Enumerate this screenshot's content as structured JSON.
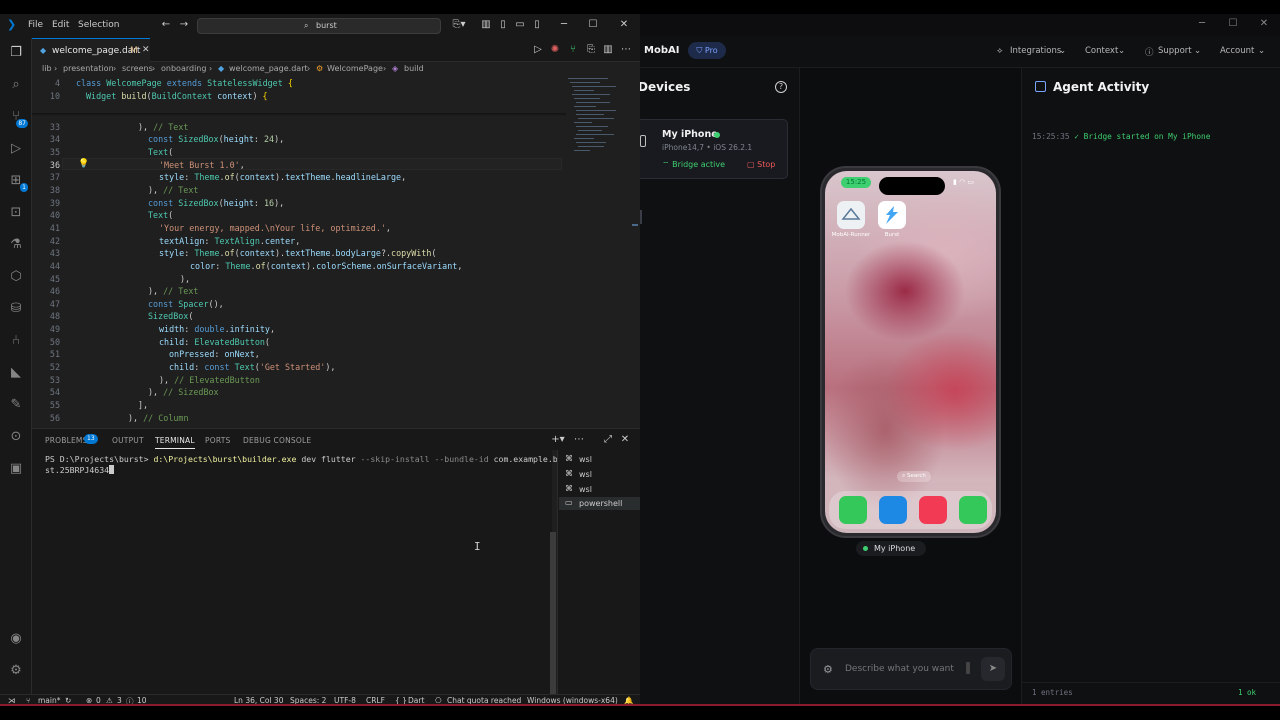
{
  "vscode": {
    "menu": [
      "File",
      "Edit",
      "Selection"
    ],
    "search": "burst",
    "tab": {
      "name": "welcome_page.dart",
      "modified": "M"
    },
    "breadcrumb": [
      "lib",
      "presentation",
      "screens",
      "onboarding",
      "welcome_page.dart",
      "WelcomePage",
      "build"
    ],
    "status": {
      "branch": "main*",
      "problems": "0",
      "warnings": "3",
      "info": "10",
      "position": "Ln 36, Col 30",
      "spaces": "Spaces: 2",
      "encoding": "UTF-8",
      "eol": "CRLF",
      "language": "Dart",
      "chat": "Chat quota reached",
      "platform": "Windows (windows-x64)"
    },
    "panel": {
      "tabs": [
        "PROBLEMS",
        "OUTPUT",
        "TERMINAL",
        "PORTS",
        "DEBUG CONSOLE"
      ],
      "problems_count": "13",
      "terminal_prompt": "PS D:\\Projects\\burst> ",
      "terminal_exe": "d:\\Projects\\burst\\builder.exe",
      "terminal_args1": " dev flutter ",
      "terminal_flags": "--skip-install --bundle-id ",
      "terminal_bundle1": "com.example.bur",
      "terminal_line2": "st.25BRPJ4634",
      "terminals": [
        "wsl",
        "wsl",
        "wsl",
        "powershell"
      ]
    },
    "activity_badges": {
      "scm": "87",
      "extensions": "1"
    }
  },
  "mobai": {
    "title": "MobAI",
    "plan": "Pro",
    "nav": [
      "Integrations",
      "Context",
      "Support",
      "Account"
    ],
    "devices_title": "Devices",
    "device": {
      "name": "My iPhone",
      "model": "iPhone14,7 • iOS 26.2.1",
      "bridge": "Bridge active",
      "stop": "Stop"
    },
    "phone": {
      "time": "15:25",
      "apps": [
        "MobAI-Runner",
        "Burst"
      ],
      "search": "Search",
      "label": "My iPhone"
    },
    "chat_placeholder": "Describe what you want",
    "activity": {
      "title": "Agent Activity",
      "log": [
        {
          "time": "15:25:35",
          "status": "✓",
          "message": "Bridge started on My iPhone"
        }
      ],
      "entries": "1 entries",
      "ok": "1 ok"
    }
  },
  "colors": {
    "accent": "#0078d4",
    "success": "#3ecf70",
    "danger": "#ef5a5a",
    "pro": "#7aa2ff"
  }
}
